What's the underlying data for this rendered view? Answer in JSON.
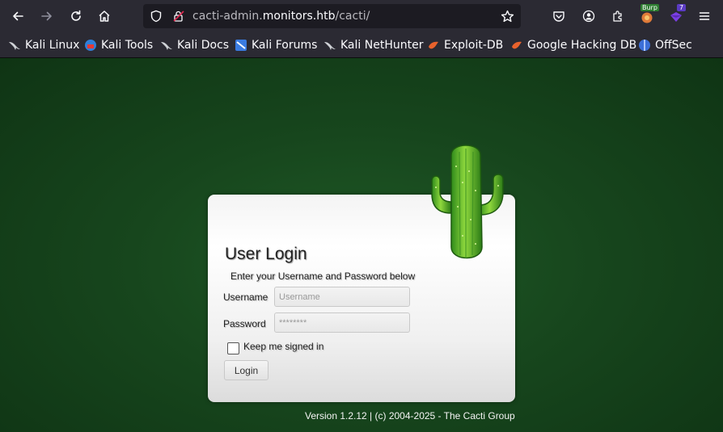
{
  "browser": {
    "url_prefix": "cacti-admin.",
    "url_domain": "monitors.htb",
    "url_path": "/cacti/",
    "extension_badge_burp": "Burp",
    "extension_badge_count": "7"
  },
  "bookmarks": [
    {
      "label": "Kali Linux",
      "icon": "kali-dragon-icon"
    },
    {
      "label": "Kali Tools",
      "icon": "kali-tools-icon"
    },
    {
      "label": "Kali Docs",
      "icon": "kali-dragon-icon"
    },
    {
      "label": "Kali Forums",
      "icon": "kali-forums-icon"
    },
    {
      "label": "Kali NetHunter",
      "icon": "kali-dragon-icon"
    },
    {
      "label": "Exploit-DB",
      "icon": "exploit-db-icon"
    },
    {
      "label": "Google Hacking DB",
      "icon": "exploit-db-icon"
    },
    {
      "label": "OffSec",
      "icon": "offsec-icon"
    }
  ],
  "login": {
    "title": "User Login",
    "subtitle": "Enter your Username and Password below",
    "username_label": "Username",
    "username_placeholder": "Username",
    "password_label": "Password",
    "password_placeholder": "********",
    "remember_label": "Keep me signed in",
    "submit_label": "Login"
  },
  "footer": {
    "version": "Version 1.2.12 | (c) 2004-2025 - The Cacti Group"
  },
  "colors": {
    "page_bg": "#17461d",
    "chrome_bg": "#2b2a33",
    "url_bg": "#1c1b22"
  }
}
